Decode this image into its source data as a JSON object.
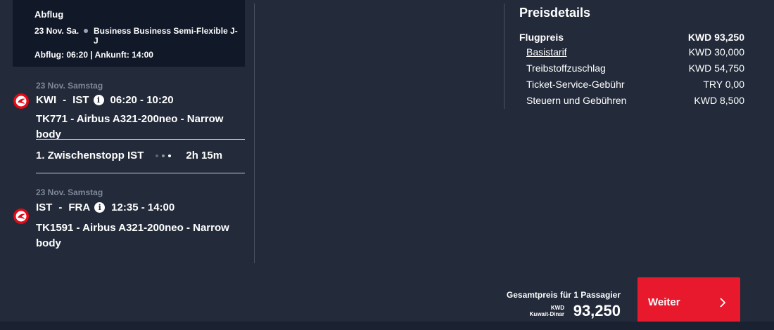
{
  "summary": {
    "title": "Abflug",
    "date": "23 Nov. Sa.",
    "fare": "Business Business Semi-Flexible J-J",
    "times": "Abflug: 06:20 | Ankunft: 14:00"
  },
  "segments": [
    {
      "date": "23 Nov. Samstag",
      "from": "KWI",
      "to": "IST",
      "times": "06:20 - 10:20",
      "flight": "TK771 - Airbus A321-200neo - Narrow body",
      "icon": "turkish-airlines-logo"
    },
    {
      "date": "23 Nov. Samstag",
      "from": "IST",
      "to": "FRA",
      "times": "12:35 - 14:00",
      "flight": "TK1591 - Airbus A321-200neo - Narrow body",
      "icon": "turkish-airlines-logo"
    }
  ],
  "stopover": {
    "label": "1. Zwischenstopp IST",
    "duration": "2h 15m"
  },
  "price": {
    "title": "Preisdetails",
    "rows": [
      {
        "label": "Flugpreis",
        "value": "KWD 93,250"
      },
      {
        "label": "Basistarif",
        "value": "KWD 30,000"
      },
      {
        "label": "Treibstoffzuschlag",
        "value": "KWD 54,750"
      },
      {
        "label": "Ticket-Service-Gebühr",
        "value": "TRY 0,00"
      },
      {
        "label": "Steuern und Gebühren",
        "value": "KWD 8,500"
      }
    ]
  },
  "total": {
    "label": "Gesamtpreis für 1 Passagier",
    "currency_code": "KWD",
    "currency_name": "Kuwait-Dinar",
    "amount": "93,250"
  },
  "actions": {
    "continue_label": "Weiter",
    "continue_icon": "chevron-right-icon"
  },
  "colors": {
    "background": "#232b3a",
    "panel": "#111827",
    "accent": "#e8192c"
  }
}
